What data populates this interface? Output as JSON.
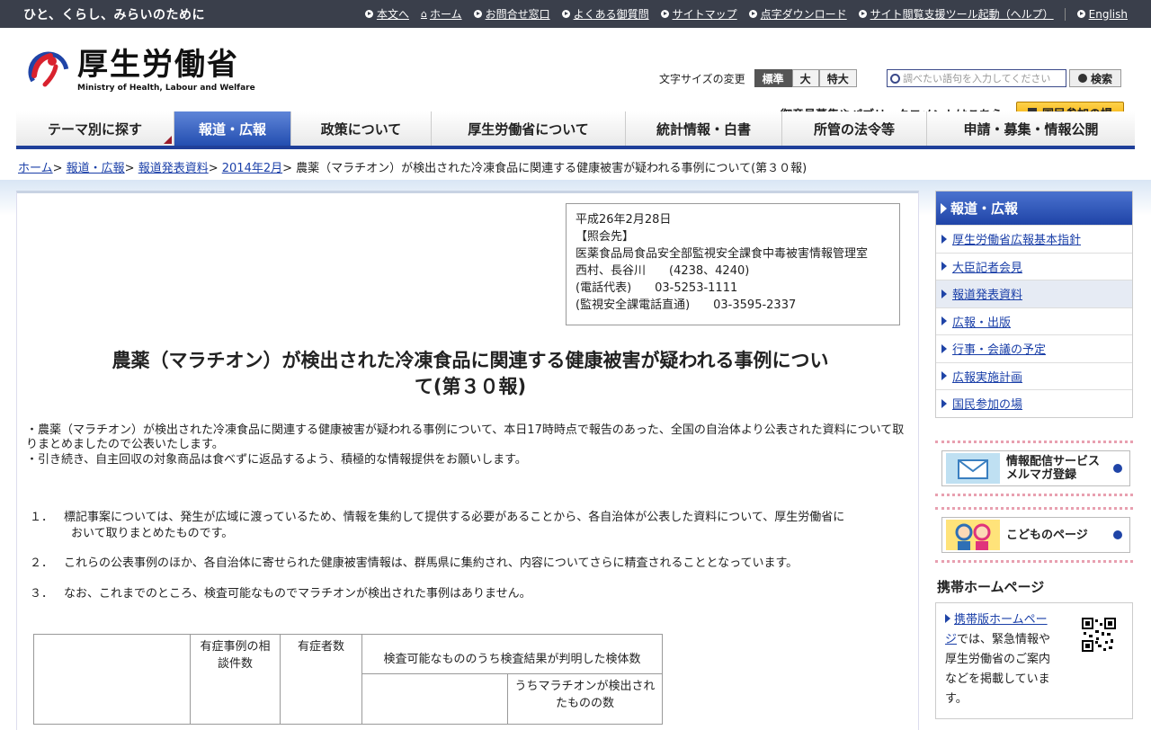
{
  "topbar": {
    "slogan": "ひと、くらし、みらいのために",
    "links": [
      "本文へ",
      "ホーム",
      "お問合せ窓口",
      "よくある御質問",
      "サイトマップ",
      "点字ダウンロード",
      "サイト閲覧支援ツール起動（ヘルプ）",
      "English"
    ]
  },
  "header": {
    "logo_jp": "厚生労働省",
    "logo_en": "Ministry of Health, Labour and Welfare",
    "fontsize_label": "文字サイズの変更",
    "fontsize_options": [
      "標準",
      "大",
      "特大"
    ],
    "search_placeholder": "調べたい語句を入力してください",
    "search_button": "検索",
    "opinion_text": "御意見募集やパブリックコメントはこちら",
    "kokumin_button": "国民参加の場"
  },
  "nav": [
    "テーマ別に探す",
    "報道・広報",
    "政策について",
    "厚生労働省について",
    "統計情報・白書",
    "所管の法令等",
    "申請・募集・情報公開"
  ],
  "breadcrumb": {
    "links": [
      "ホーム",
      "報道・広報",
      "報道発表資料",
      "2014年2月"
    ],
    "current": "農薬（マラチオン）が検出された冷凍食品に関連する健康被害が疑われる事例について(第３０報)"
  },
  "contact": {
    "date": "平成26年2月28日",
    "heading": "【照会先】",
    "dept": "医薬食品局食品安全部監視安全課食中毒被害情報管理室",
    "names": "西村、長谷川　　(4238、4240)",
    "tel1": "(電話代表)　　03-5253-1111",
    "tel2": "(監視安全課電話直通)　　03-3595-2337"
  },
  "article": {
    "title_line1": "農薬（マラチオン）が検出された冷凍食品に関連する健康被害が疑われる事例につい",
    "title_line2": "て(第３０報)",
    "lead1": "・農薬（マラチオン）が検出された冷凍食品に関連する健康被害が疑われる事例について、本日17時時点で報告のあった、全国の自治体より公表された資料について取りまとめましたので公表いたします。",
    "lead2": "・引き続き、自主回収の対象商品は食べずに返品するよう、積極的な情報提供をお願いします。",
    "items": [
      {
        "num": "１．",
        "text": "標記事案については、発生が広域に渡っているため、情報を集約して提供する必要があることから、各自治体が公表した資料について、厚生労働省に",
        "cont": "おいて取りまとめたものです。"
      },
      {
        "num": "２．",
        "text": "これらの公表事例のほか、各自治体に寄せられた健康被害情報は、群馬県に集約され、内容についてさらに精査されることとなっています。",
        "cont": ""
      },
      {
        "num": "３．",
        "text": "なお、これまでのところ、検査可能なものでマラチオンが検出された事例はありません。",
        "cont": ""
      }
    ],
    "table": {
      "h1": "有症事例の相談件数",
      "h2": "有症者数",
      "h3": "検査可能なもののうち検査結果が判明した検体数",
      "h3sub": "うちマラチオンが検出されたものの数"
    }
  },
  "sidebar": {
    "heading": "報道・広報",
    "items": [
      "厚生労働省広報基本指針",
      "大臣記者会見",
      "報道発表資料",
      "広報・出版",
      "行事・会議の予定",
      "広報実施計画",
      "国民参加の場"
    ],
    "mail_banner_line1": "情報配信サービス",
    "mail_banner_line2": "メルマガ登録",
    "kids_banner": "こどものページ",
    "mobile_heading": "携帯ホームページ",
    "mobile_link": "携帯版ホームページ",
    "mobile_text": "では、緊急情報や厚生労働省のご案内などを掲載しています。"
  }
}
